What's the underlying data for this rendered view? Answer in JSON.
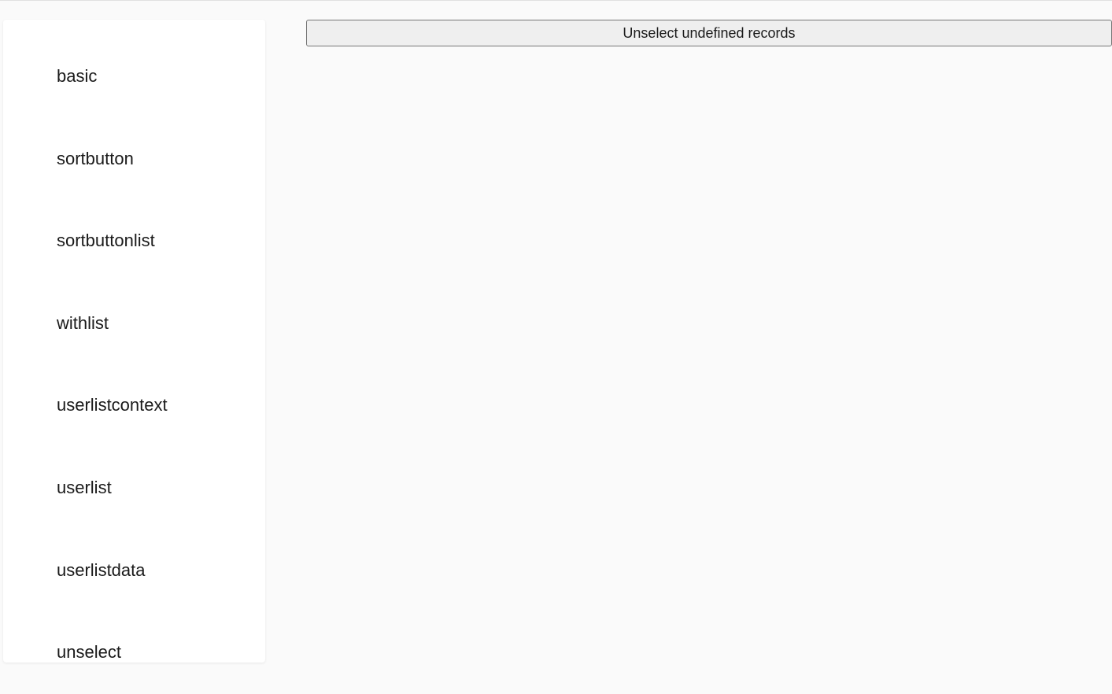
{
  "sidebar": {
    "items": [
      {
        "label": "basic"
      },
      {
        "label": "sortbutton"
      },
      {
        "label": "sortbuttonlist"
      },
      {
        "label": "withlist"
      },
      {
        "label": "userlistcontext"
      },
      {
        "label": "userlist"
      },
      {
        "label": "userlistdata"
      },
      {
        "label": "unselect"
      }
    ]
  },
  "main": {
    "unselect_button_label": "Unselect undefined records"
  }
}
